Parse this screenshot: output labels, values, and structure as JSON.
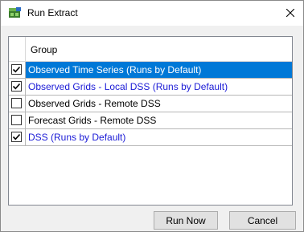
{
  "window": {
    "title": "Run Extract",
    "app_icon": "run-extract-icon",
    "close_icon": "close-icon"
  },
  "table": {
    "header": "Group",
    "rows": [
      {
        "label": "Observed Time Series (Runs by Default)",
        "checked": true,
        "selected": true,
        "style": "selected"
      },
      {
        "label": "Observed Grids - Local DSS (Runs by Default)",
        "checked": true,
        "selected": false,
        "style": "blue"
      },
      {
        "label": "Observed Grids - Remote DSS",
        "checked": false,
        "selected": false,
        "style": "plain"
      },
      {
        "label": "Forecast Grids - Remote DSS",
        "checked": false,
        "selected": false,
        "style": "plain"
      },
      {
        "label": "DSS (Runs by Default)",
        "checked": true,
        "selected": false,
        "style": "blue"
      }
    ]
  },
  "buttons": {
    "run_now": "Run Now",
    "cancel": "Cancel"
  },
  "colors": {
    "selection": "#0078d7",
    "default_run_text": "#1a1ad6"
  }
}
